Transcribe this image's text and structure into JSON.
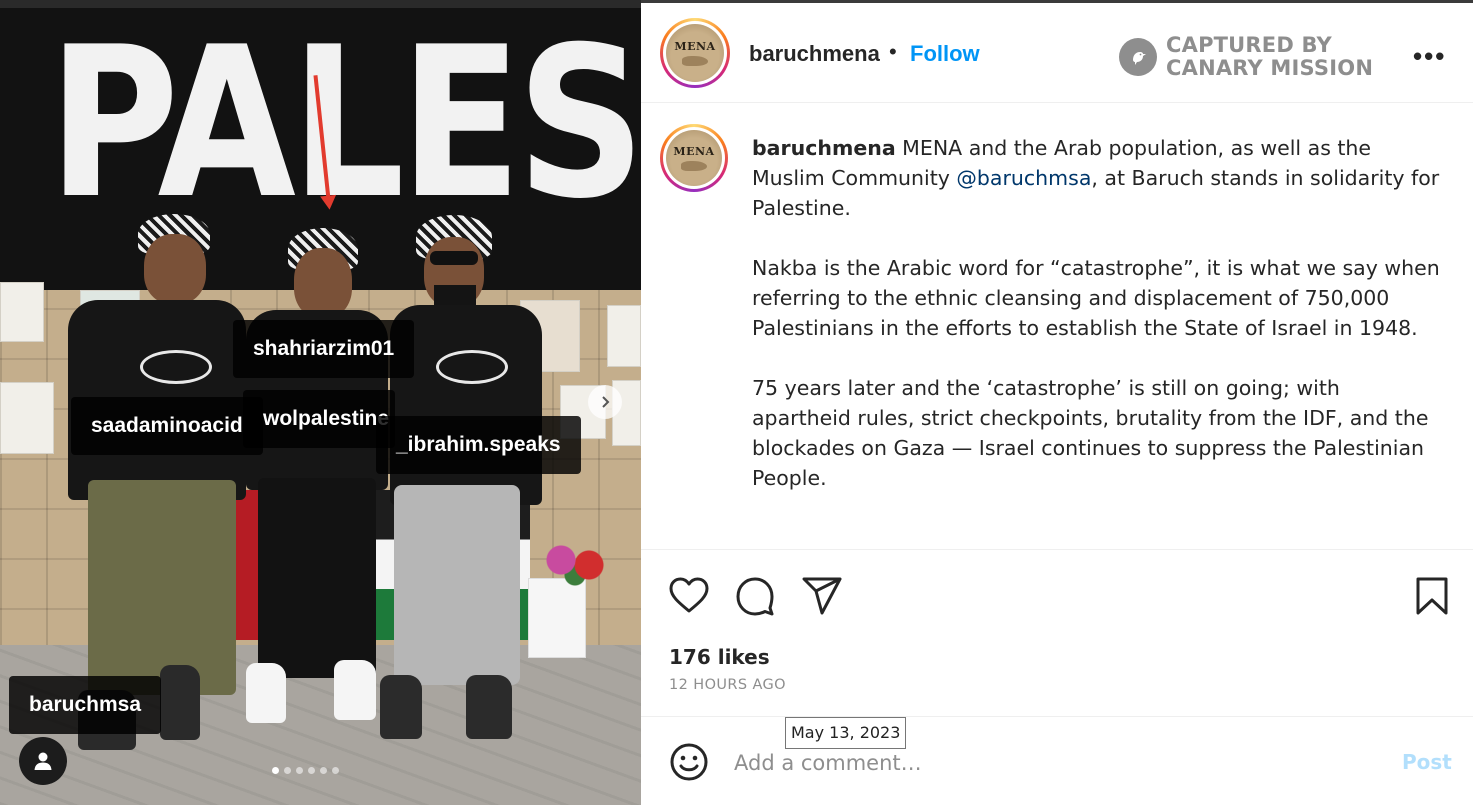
{
  "photo": {
    "banner_text": "PALESTIN",
    "tags": [
      {
        "username": "shahriarzim01"
      },
      {
        "username": "saadaminoacid"
      },
      {
        "username": "wolpalestine"
      },
      {
        "username": "_ibrahim.speaks"
      },
      {
        "username": "baruchmsa"
      }
    ],
    "carousel_count": 6,
    "carousel_active": 1
  },
  "header": {
    "avatar_text": "MENA",
    "username": "baruchmena",
    "separator": "•",
    "follow_label": "Follow",
    "watermark_line1": "CAPTURED BY",
    "watermark_line2": "CANARY MISSION",
    "more_label": "•••"
  },
  "caption": {
    "avatar_text": "MENA",
    "username": "baruchmena",
    "p1_before": " MENA and the Arab population, as well as the Muslim Community ",
    "p1_mention": "@baruchmsa",
    "p1_after": ", at Baruch stands in solidarity for Palestine.",
    "p2": "Nakba is the Arabic word for “catastrophe”, it is what we say when referring to the ethnic cleansing and displacement of 750,000 Palestinians in the efforts to establish the State of Israel in 1948.",
    "p3": "75 years later and the ‘catastrophe’ is still on going; with apartheid rules, strict checkpoints, brutality from the IDF, and the blockades on Gaza — Israel continues to suppress the Palestinian People."
  },
  "actions": {
    "icons": [
      "heart-icon",
      "comment-icon",
      "share-icon",
      "bookmark-icon"
    ],
    "likes_text": "176 likes",
    "time_text": "12 HOURS AGO",
    "tooltip_date": "May 13, 2023"
  },
  "comment": {
    "placeholder": "Add a comment…",
    "post_label": "Post"
  },
  "colors": {
    "follow": "#0095f6",
    "mention": "#00376b",
    "post_disabled": "#b2dffc",
    "muted": "#8e8e8e"
  }
}
